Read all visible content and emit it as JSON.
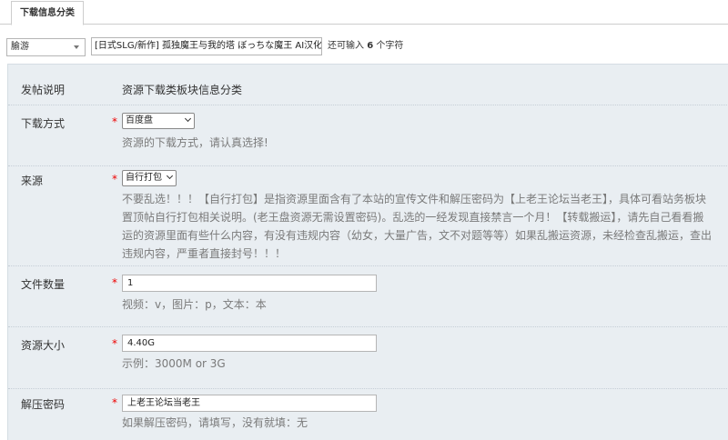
{
  "tabs": [
    {
      "label": "下载信息分类"
    }
  ],
  "subject": {
    "type_value": "腧游",
    "title_value": "[日式SLG/新作] 孤独魔王与我的塔 ぼっちな魔王 AI汉化",
    "char_tip_prefix": "还可输入",
    "char_tip_count": "6",
    "char_tip_suffix": "个字符"
  },
  "form": {
    "post_note": {
      "label": "发帖说明",
      "value": "资源下载类板块信息分类"
    },
    "download_method": {
      "label": "下载方式",
      "required": "*",
      "selected": "百度盘",
      "desc": "资源的下载方式，请认真选择!"
    },
    "source": {
      "label": "来源",
      "required": "*",
      "selected": "自行打包",
      "desc_lines": [
        "不要乱选！！！【自行打包】是指资源里面含有了本站的宣传文件和解压密码为【上老王论坛当老王】，具体可看站务板块",
        "置顶帖自行打包相关说明。(老王盘资源无需设置密码)。乱选的一经发现直接禁言一个月！【转载搬运】，请先自己看看搬",
        "运的资源里面有些什么内容，有没有违规内容（幼女，大量广告，文不对题等等）如果乱搬运资源，未经检查乱搬运，查出",
        "违规内容，严重者直接封号！！！"
      ]
    },
    "file_count": {
      "label": "文件数量",
      "required": "*",
      "value": "1",
      "desc": "视频：v，图片：p，文本：本"
    },
    "resource_size": {
      "label": "资源大小",
      "required": "*",
      "value": "4.40G",
      "desc": "示例：3000M or 3G"
    },
    "unzip_password": {
      "label": "解压密码",
      "required": "*",
      "value": "上老王论坛当老王",
      "desc": "如果解压密码，请填写，没有就填：无"
    }
  }
}
